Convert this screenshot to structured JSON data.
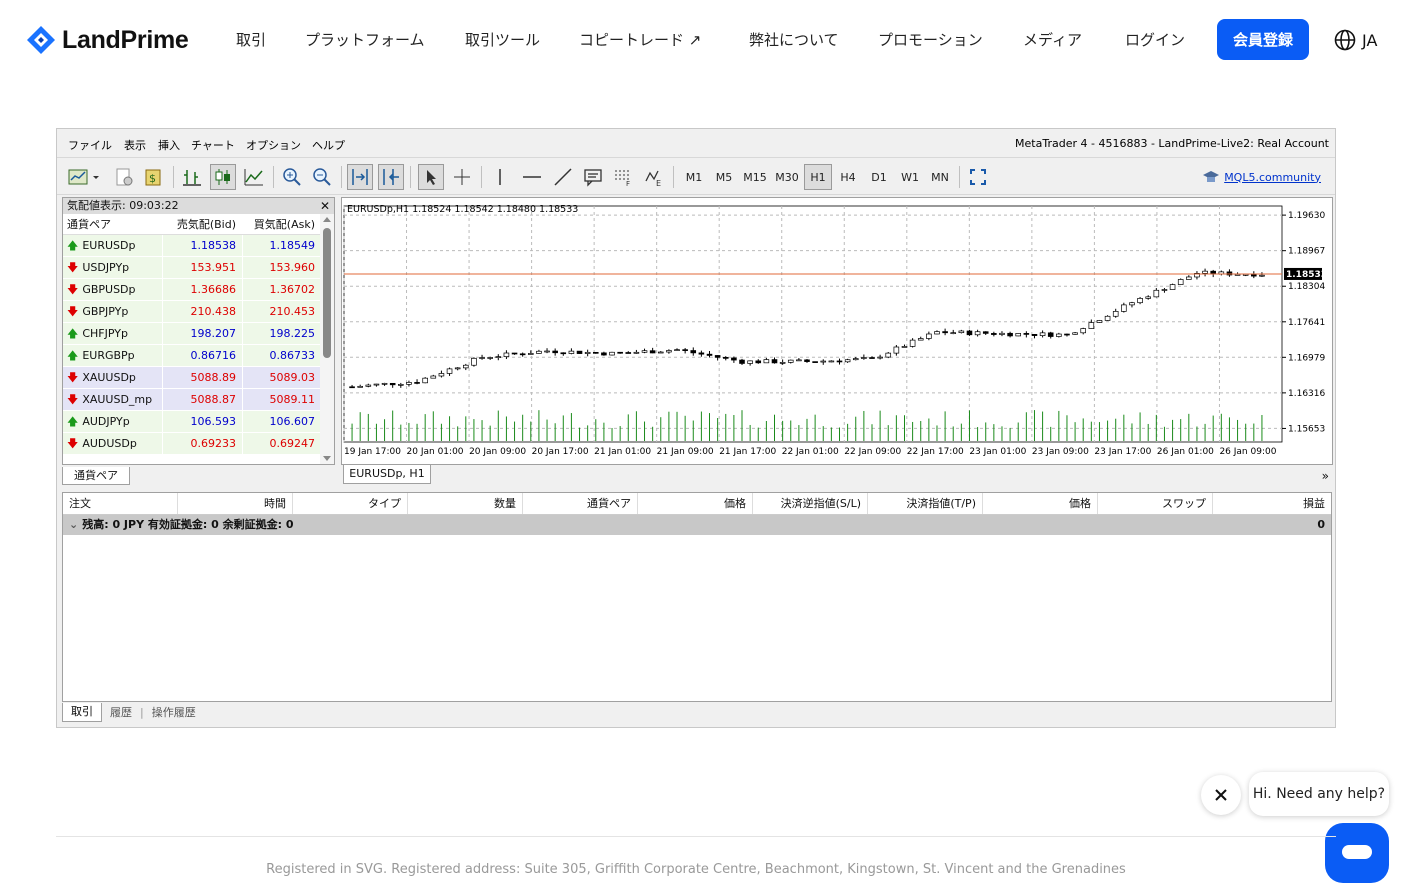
{
  "nav": {
    "brand": "LandPrime",
    "links": [
      "取引",
      "プラットフォーム",
      "取引ツール",
      "コピートレード",
      "弊社について",
      "プロモーション",
      "メディア",
      "ログイン"
    ],
    "register": "会員登録",
    "lang": "JA"
  },
  "mt4": {
    "menu": [
      "ファイル",
      "表示",
      "挿入",
      "チャート",
      "オプション",
      "ヘルプ"
    ],
    "title": "MetaTrader 4 - 4516883 - LandPrime-Live2: Real Account",
    "timeframes": [
      "M1",
      "M5",
      "M15",
      "M30",
      "H1",
      "H4",
      "D1",
      "W1",
      "MN"
    ],
    "active_timeframe": "H1",
    "mql": "MQL5.community",
    "marketwatch": {
      "title": "気配値表示: 09:03:22",
      "cols": [
        "通貨ペア",
        "売気配(Bid)",
        "買気配(Ask)"
      ],
      "rows": [
        {
          "s": "EURUSDp",
          "b": "1.18538",
          "a": "1.18549",
          "d": "up"
        },
        {
          "s": "USDJPYp",
          "b": "153.951",
          "a": "153.960",
          "d": "down"
        },
        {
          "s": "GBPUSDp",
          "b": "1.36686",
          "a": "1.36702",
          "d": "down"
        },
        {
          "s": "GBPJPYp",
          "b": "210.438",
          "a": "210.453",
          "d": "down"
        },
        {
          "s": "CHFJPYp",
          "b": "198.207",
          "a": "198.225",
          "d": "up"
        },
        {
          "s": "EURGBPp",
          "b": "0.86716",
          "a": "0.86733",
          "d": "up"
        },
        {
          "s": "XAUUSDp",
          "b": "5088.89",
          "a": "5089.03",
          "d": "down"
        },
        {
          "s": "XAUUSD_mp",
          "b": "5088.87",
          "a": "5089.11",
          "d": "down"
        },
        {
          "s": "AUDJPYp",
          "b": "106.593",
          "a": "106.607",
          "d": "up"
        },
        {
          "s": "AUDUSDp",
          "b": "0.69233",
          "a": "0.69247",
          "d": "down"
        }
      ],
      "tab": "通貨ペア"
    },
    "chart": {
      "header": "EURUSDp,H1  1.18524 1.18542 1.18480 1.18533",
      "tab": "EURUSDp, H1",
      "current": "1.18533",
      "yticks": [
        "1.19630",
        "1.18967",
        "1.18304",
        "1.17641",
        "1.16979",
        "1.16316",
        "1.15653"
      ],
      "xticks": [
        "19 Jan 17:00",
        "20 Jan 01:00",
        "20 Jan 09:00",
        "20 Jan 17:00",
        "21 Jan 01:00",
        "21 Jan 09:00",
        "21 Jan 17:00",
        "22 Jan 01:00",
        "22 Jan 09:00",
        "22 Jan 17:00",
        "23 Jan 01:00",
        "23 Jan 09:00",
        "23 Jan 17:00",
        "26 Jan 01:00",
        "26 Jan 09:00"
      ]
    },
    "terminal": {
      "cols": [
        "注文",
        "時間",
        "タイプ",
        "数量",
        "通貨ペア",
        "価格",
        "決済逆指値(S/L)",
        "決済指値(T/P)",
        "価格",
        "スワップ",
        "損益"
      ],
      "balance": "残高: 0 JPY  有効証拠金: 0  余剰証拠金: 0",
      "profit": "0",
      "tabs": [
        "取引",
        "履歴",
        "操作履歴"
      ]
    }
  },
  "chart_data": {
    "type": "line",
    "title": "EURUSDp,H1",
    "x": [
      "19 Jan 17:00",
      "20 Jan 01:00",
      "20 Jan 09:00",
      "20 Jan 17:00",
      "21 Jan 01:00",
      "21 Jan 09:00",
      "21 Jan 17:00",
      "22 Jan 01:00",
      "22 Jan 09:00",
      "22 Jan 17:00",
      "23 Jan 01:00",
      "23 Jan 09:00",
      "23 Jan 17:00",
      "26 Jan 01:00",
      "26 Jan 09:00"
    ],
    "series": [
      {
        "values": [
          1.1643,
          1.1653,
          1.1698,
          1.171,
          1.1705,
          1.1712,
          1.169,
          1.169,
          1.1695,
          1.1745,
          1.1742,
          1.174,
          1.18,
          1.1855,
          1.1853
        ]
      }
    ],
    "ylim": [
      1.154,
      1.198
    ]
  },
  "chat": {
    "msg": "Hi. Need any help?"
  },
  "footer": "Registered in SVG. Registered address: Suite 305, Griffith Corporate Centre, Beachmont, Kingstown, St. Vincent and the Grenadines"
}
